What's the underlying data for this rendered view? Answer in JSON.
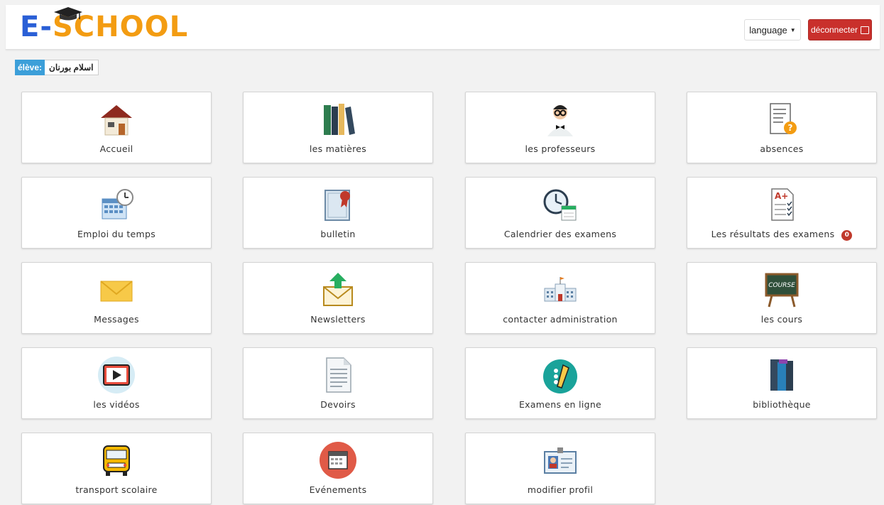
{
  "header": {
    "logo_e": "E",
    "logo_dash": "-",
    "logo_rest": "SCHOOL",
    "language_label": "language",
    "logout_label": "déconnecter"
  },
  "user": {
    "role": "élève:",
    "name": "اسلام بورنان"
  },
  "tiles": [
    {
      "label": "Accueil",
      "icon": "house-icon"
    },
    {
      "label": "les matières",
      "icon": "books-icon"
    },
    {
      "label": "les professeurs",
      "icon": "teacher-icon"
    },
    {
      "label": "absences",
      "icon": "clipboard-question-icon"
    },
    {
      "label": "Emploi du temps",
      "icon": "calendar-clock-icon"
    },
    {
      "label": "bulletin",
      "icon": "certificate-icon"
    },
    {
      "label": "Calendrier des examens",
      "icon": "clock-calendar-icon"
    },
    {
      "label": "Les résultats des examens",
      "icon": "graded-paper-icon",
      "badge": "0"
    },
    {
      "label": "Messages",
      "icon": "envelope-icon"
    },
    {
      "label": "Newsletters",
      "icon": "envelope-upload-icon"
    },
    {
      "label": "contacter administration",
      "icon": "building-icon"
    },
    {
      "label": "les cours",
      "icon": "chalkboard-icon",
      "board_text": "COURSE"
    },
    {
      "label": "les vidéos",
      "icon": "video-play-icon"
    },
    {
      "label": "Devoirs",
      "icon": "document-icon"
    },
    {
      "label": "Examens en ligne",
      "icon": "online-exam-icon"
    },
    {
      "label": "bibliothèque",
      "icon": "library-books-icon"
    },
    {
      "label": "transport scolaire",
      "icon": "school-bus-icon"
    },
    {
      "label": "Evénements",
      "icon": "events-calendar-icon"
    },
    {
      "label": "modifier profil",
      "icon": "id-card-icon"
    }
  ],
  "colors": {
    "logo_blue": "#2a5fd6",
    "logo_orange": "#f39c12",
    "logout_red": "#c9302c",
    "role_blue": "#3c9fd9",
    "badge_red": "#c0392b"
  }
}
